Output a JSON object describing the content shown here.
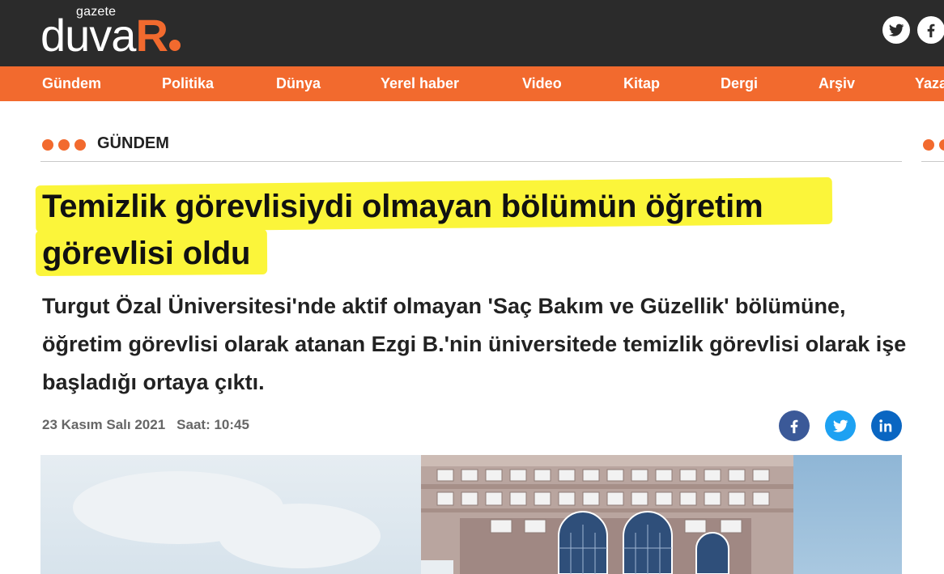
{
  "header": {
    "logo_small": "gazete",
    "logo_main": "duva",
    "logo_accent": "R",
    "social": [
      "twitter-icon",
      "facebook-icon"
    ]
  },
  "nav": {
    "items": [
      "Gündem",
      "Politika",
      "Dünya",
      "Yerel haber",
      "Video",
      "Kitap",
      "Dergi",
      "Arşiv",
      "Yaza"
    ]
  },
  "article": {
    "category": "GÜNDEM",
    "title": "Temizlik görevlisiydi olmayan bölümün öğretim görevlisi oldu",
    "summary": "Turgut Özal Üniversitesi'nde aktif olmayan 'Saç Bakım ve Güzellik' bölümüne, öğretim görevlisi olarak atanan Ezgi B.'nin üniversitede temizlik görevlisi olarak işe başladığı ortaya çıktı.",
    "date": "23 Kasım Salı 2021",
    "time": "Saat: 10:45",
    "share": [
      "facebook-icon",
      "twitter-icon",
      "linkedin-icon"
    ]
  },
  "colors": {
    "brand_orange": "#f26a2e",
    "header_dark": "#2b2b2b",
    "highlight": "#fbf53a"
  }
}
